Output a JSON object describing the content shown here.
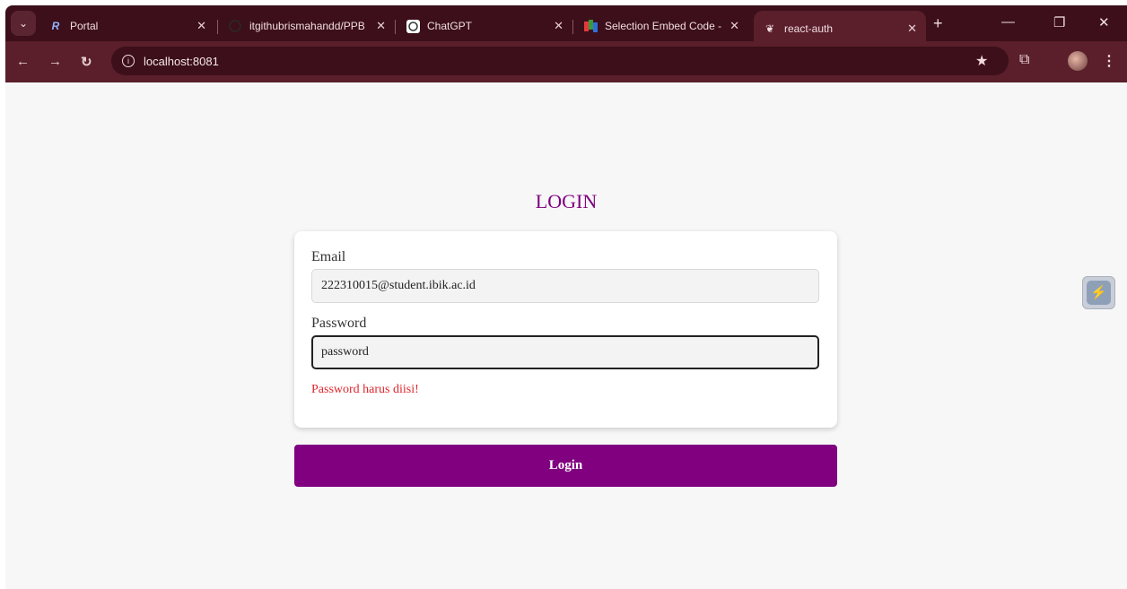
{
  "browser": {
    "tabs": [
      {
        "title": "Portal",
        "favicon": "portal-favicon",
        "active": false
      },
      {
        "title": "itgithubrismahandd/PPB",
        "favicon": "github-favicon",
        "active": false
      },
      {
        "title": "ChatGPT",
        "favicon": "chatgpt-favicon",
        "active": false
      },
      {
        "title": "Selection Embed Code -",
        "favicon": "zoho-favicon",
        "active": false
      },
      {
        "title": "react-auth",
        "favicon": "react-auth-favicon",
        "active": true
      }
    ],
    "url": "localhost:8081"
  },
  "page": {
    "title": "LOGIN",
    "email": {
      "label": "Email",
      "value": "222310015@student.ibik.ac.id"
    },
    "password": {
      "label": "Password",
      "value": "password"
    },
    "error": "Password harus diisi!",
    "submit_label": "Login"
  },
  "colors": {
    "accent": "#800080",
    "error": "#e0262c",
    "chrome_dark": "#3c0f1a",
    "chrome_mid": "#5a1f2b"
  }
}
